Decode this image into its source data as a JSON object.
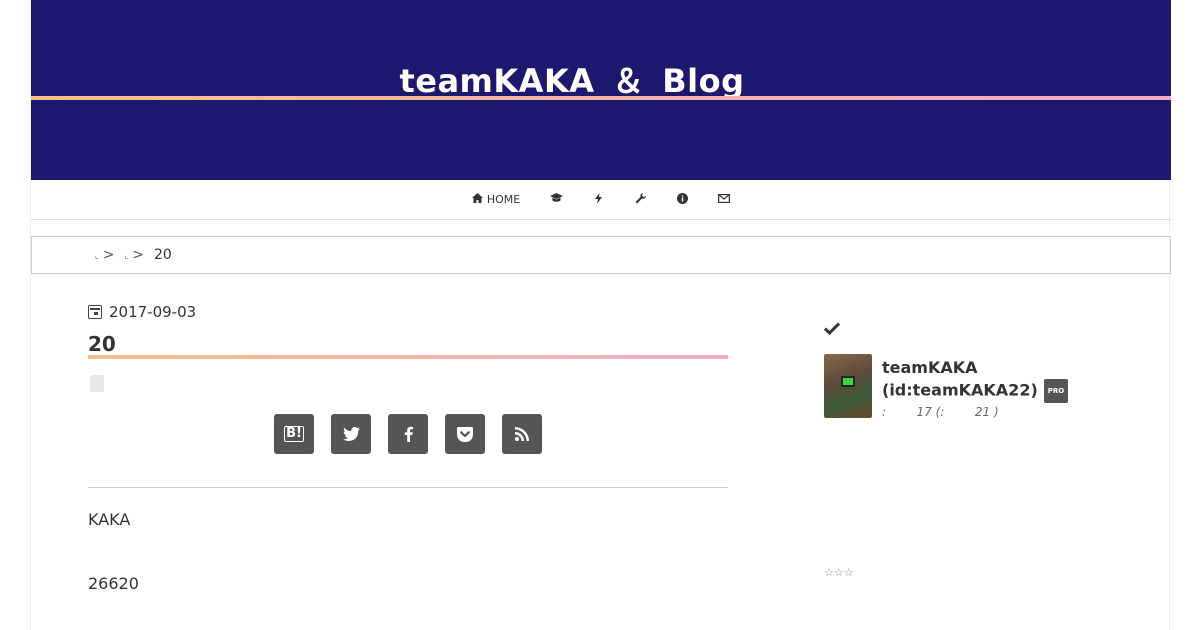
{
  "header": {
    "site_title": "teamKAKA ＆ Blog",
    "bg_color": "#1b186e",
    "accent_gradient": [
      "#f7c08a",
      "#f5a9c8"
    ]
  },
  "nav": {
    "items": [
      {
        "icon": "home-icon",
        "label": "HOME"
      },
      {
        "icon": "graduation-cap-icon",
        "label": ""
      },
      {
        "icon": "bolt-icon",
        "label": ""
      },
      {
        "icon": "wrench-icon",
        "label": ""
      },
      {
        "icon": "info-circle-icon",
        "label": ""
      },
      {
        "icon": "envelope-icon",
        "label": ""
      }
    ]
  },
  "breadcrumb": {
    "sep": ">",
    "current": "20"
  },
  "article": {
    "date": "2017-09-03",
    "title": "20",
    "share_buttons": [
      "hatena-bookmark-icon",
      "twitter-icon",
      "facebook-icon",
      "pocket-icon",
      "rss-icon"
    ],
    "hatena_label": "B!",
    "paragraphs": [
      "KAKA",
      "26620"
    ]
  },
  "sidebar": {
    "profile_name": "teamKAKA",
    "profile_id": "(id:teamKAKA22)",
    "pro_badge": "PRO",
    "stats": ":        17 (:        21 )",
    "stars": "☆☆☆"
  }
}
